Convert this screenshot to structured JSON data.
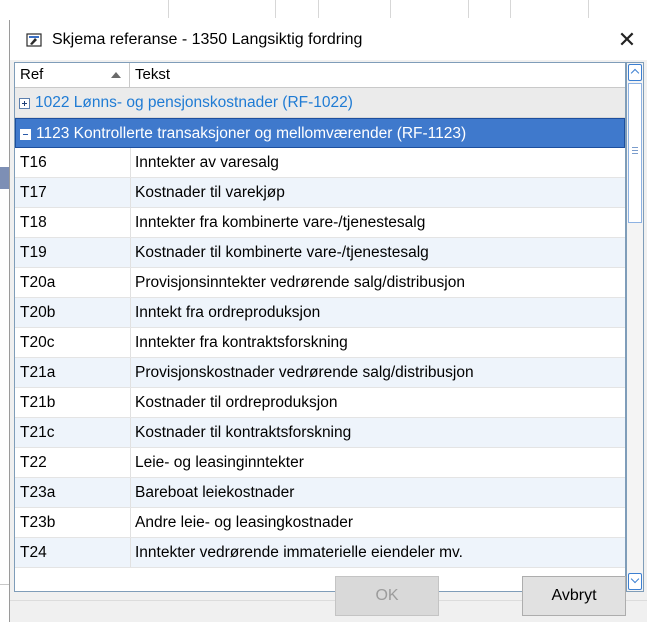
{
  "window": {
    "title": "Skjema referanse - 1350  Langsiktig fordring",
    "close_glyph": "✕"
  },
  "grid": {
    "columns": {
      "ref": "Ref",
      "text": "Tekst"
    },
    "sort": {
      "column": "Ref",
      "direction": "ascending"
    },
    "groups": [
      {
        "label": "1022  Lønns- og pensjonskostnader (RF-1022)",
        "state": "collapsed"
      },
      {
        "label": "1123  Kontrollerte transaksjoner og mellomværender (RF-1123)",
        "state": "expanded",
        "selected": true
      }
    ],
    "rows": [
      {
        "ref": "T16",
        "text": "Inntekter av varesalg"
      },
      {
        "ref": "T17",
        "text": "Kostnader til varekjøp"
      },
      {
        "ref": "T18",
        "text": "Inntekter fra kombinerte vare-/tjenestesalg"
      },
      {
        "ref": "T19",
        "text": "Kostnader til kombinerte vare-/tjenestesalg"
      },
      {
        "ref": "T20a",
        "text": "Provisjonsinntekter vedrørende salg/distribusjon"
      },
      {
        "ref": "T20b",
        "text": "Inntekt fra ordreproduksjon"
      },
      {
        "ref": "T20c",
        "text": "Inntekter fra kontraktsforskning"
      },
      {
        "ref": "T21a",
        "text": "Provisjonskostnader vedrørende salg/distribusjon"
      },
      {
        "ref": "T21b",
        "text": "Kostnader til ordreproduksjon"
      },
      {
        "ref": "T21c",
        "text": "Kostnader til kontraktsforskning"
      },
      {
        "ref": "T22",
        "text": "Leie- og leasinginntekter"
      },
      {
        "ref": "T23a",
        "text": "Bareboat leiekostnader"
      },
      {
        "ref": "T23b",
        "text": "Andre leie- og leasingkostnader"
      },
      {
        "ref": "T24",
        "text": "Inntekter vedrørende immaterielle eiendeler mv."
      }
    ]
  },
  "buttons": {
    "ok": "OK",
    "cancel": "Avbryt"
  },
  "colors": {
    "accent": "#3f79cc",
    "group_link": "#1f7bd4",
    "border": "#7f9db9"
  }
}
